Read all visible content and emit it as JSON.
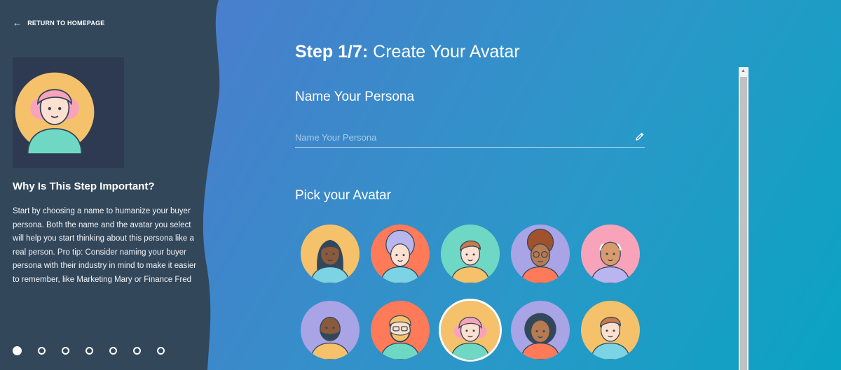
{
  "sidebar": {
    "back_label": "RETURN TO HOMEPAGE",
    "why_title": "Why Is This Step Important?",
    "why_text": "Start by choosing a name to humanize your buyer persona. Both the name and the avatar you select will help you start thinking about this persona like a real person. Pro tip: Consider naming your buyer persona with their industry in mind to make it easier to remember, like Marketing Mary or Finance Fred",
    "total_steps": 7,
    "active_step": 1
  },
  "main": {
    "step_number": "Step 1/7:",
    "step_title": "Create Your Avatar",
    "name_section_title": "Name Your Persona",
    "name_input": {
      "placeholder": "Name Your Persona",
      "value": ""
    },
    "avatar_section_title": "Pick your Avatar",
    "selected_avatar_index": 7
  },
  "icons": {
    "back": "arrow-left-icon",
    "edit": "pencil-icon"
  },
  "colors": {
    "sidebar": "#33475b",
    "preview_box": "#2d3a52",
    "avatar_yellow": "#f5c26b",
    "avatar_orange": "#ff7a59",
    "avatar_teal": "#6fd8c5",
    "avatar_lavender": "#a8a4e6",
    "avatar_pink": "#f9a3bb"
  }
}
